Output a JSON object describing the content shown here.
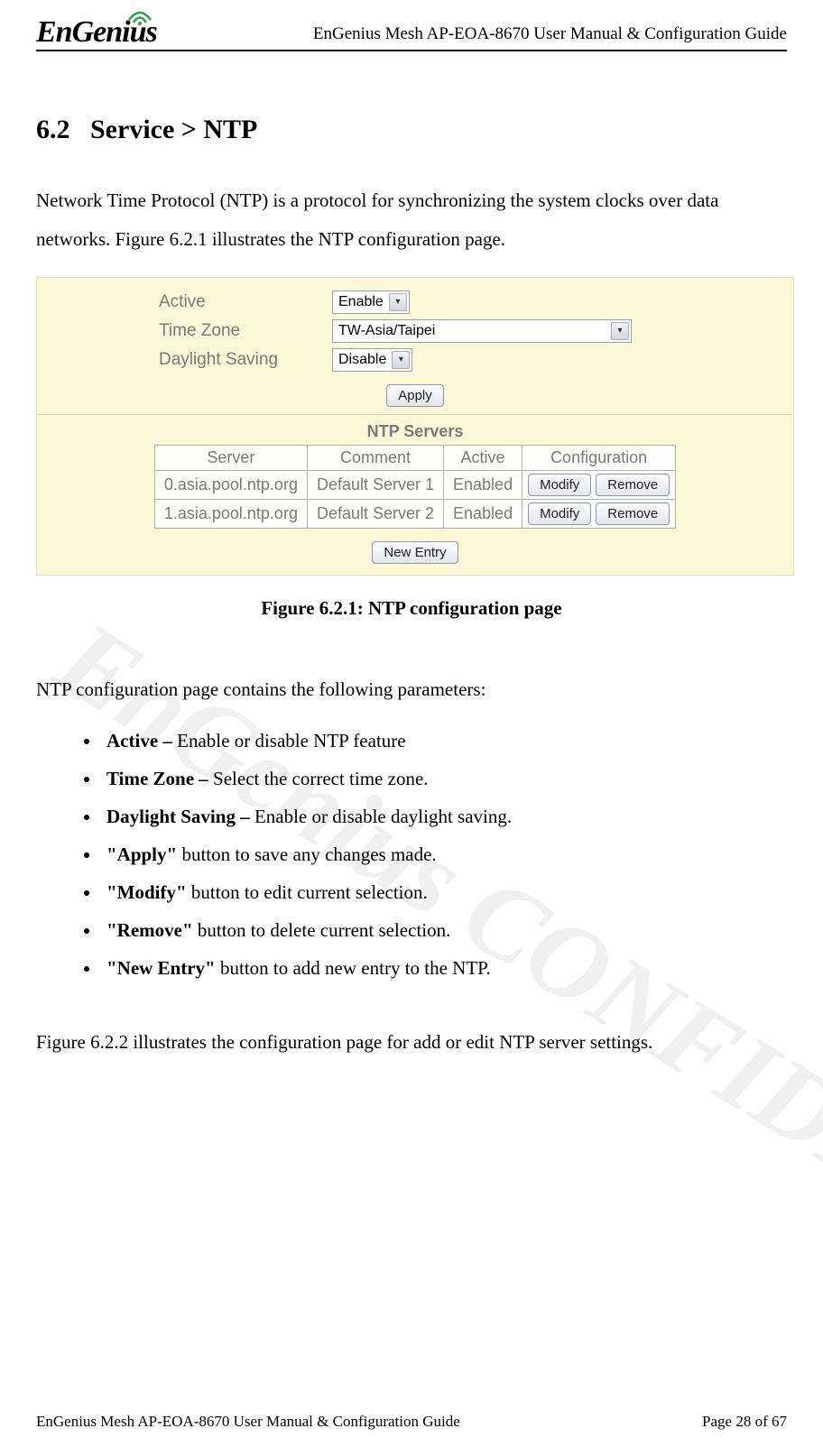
{
  "watermark": "EnGenius CONFIDE",
  "header": {
    "logo": "EnGenius",
    "title": "EnGenius Mesh AP-EOA-8670 User Manual & Configuration Guide"
  },
  "section": {
    "number": "6.2",
    "title": "Service > NTP"
  },
  "intro": "Network Time Protocol (NTP) is a protocol for synchronizing the system clocks over data networks. Figure 6.2.1 illustrates the NTP configuration page.",
  "figure": {
    "caption": "Figure 6.2.1: NTP configuration page",
    "form": {
      "active": {
        "label": "Active",
        "value": "Enable"
      },
      "timezone": {
        "label": "Time Zone",
        "value": "TW-Asia/Taipei"
      },
      "daylight": {
        "label": "Daylight Saving",
        "value": "Disable"
      },
      "apply_label": "Apply"
    },
    "ntp_servers": {
      "title": "NTP Servers",
      "headers": {
        "server": "Server",
        "comment": "Comment",
        "active": "Active",
        "config": "Configuration"
      },
      "rows": [
        {
          "server": "0.asia.pool.ntp.org",
          "comment": "Default Server 1",
          "active": "Enabled",
          "modify": "Modify",
          "remove": "Remove"
        },
        {
          "server": "1.asia.pool.ntp.org",
          "comment": "Default Server 2",
          "active": "Enabled",
          "modify": "Modify",
          "remove": "Remove"
        }
      ],
      "new_entry_label": "New Entry"
    }
  },
  "params_intro": "NTP configuration page contains the following parameters:",
  "params": [
    {
      "bold": "Active – ",
      "text": "Enable or disable NTP feature"
    },
    {
      "bold": "Time Zone – ",
      "text": "Select the correct time zone."
    },
    {
      "bold": "Daylight Saving – ",
      "text": "Enable or disable daylight saving."
    },
    {
      "bold": "\"Apply\"",
      "text": " button to save any changes made."
    },
    {
      "bold": "\"Modify\"",
      "text": " button to edit current selection."
    },
    {
      "bold": "\"Remove\"",
      "text": " button to delete current selection."
    },
    {
      "bold": "\"New Entry\"",
      "text": " button to add new entry to the NTP."
    }
  ],
  "outro": "Figure 6.2.2 illustrates the configuration page for add or edit NTP server settings.",
  "footer": {
    "left": "EnGenius Mesh AP-EOA-8670 User Manual & Configuration Guide",
    "right": "Page 28 of 67"
  }
}
